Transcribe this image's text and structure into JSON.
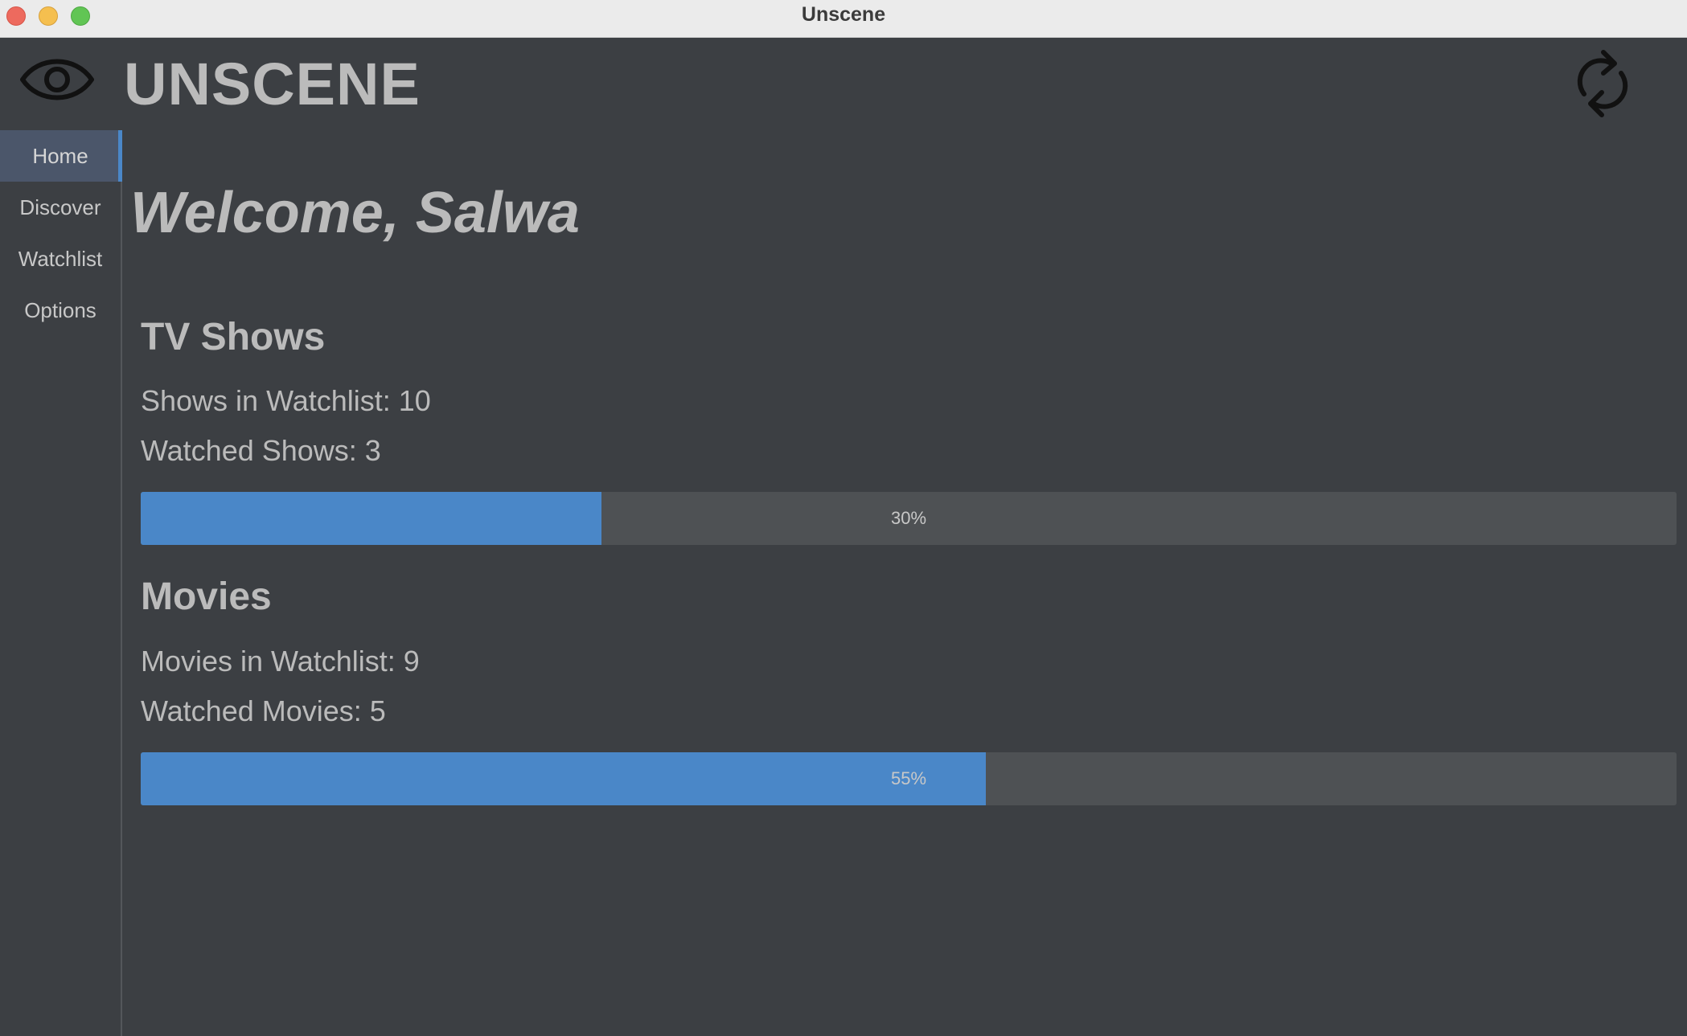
{
  "window": {
    "title": "Unscene"
  },
  "header": {
    "app_name": "UNSCENE"
  },
  "sidebar": {
    "items": [
      {
        "label": "Home",
        "active": true
      },
      {
        "label": "Discover",
        "active": false
      },
      {
        "label": "Watchlist",
        "active": false
      },
      {
        "label": "Options",
        "active": false
      }
    ]
  },
  "main": {
    "welcome": "Welcome, Salwa",
    "tv": {
      "title": "TV Shows",
      "watchlist_text": "Shows in Watchlist: 10",
      "watched_text": "Watched Shows: 3",
      "progress_label": "30%",
      "progress_fraction": 0.3
    },
    "movies": {
      "title": "Movies",
      "watchlist_text": "Movies in Watchlist: 9",
      "watched_text": "Watched Movies: 5",
      "progress_label": "55%",
      "progress_fraction": 0.55
    }
  },
  "colors": {
    "background": "#3c3f43",
    "accent": "#4a87c8",
    "text": "#bbbbbb",
    "progress_track": "#4e5154"
  },
  "icons": {
    "logo": "eye-icon",
    "refresh": "refresh-icon"
  }
}
